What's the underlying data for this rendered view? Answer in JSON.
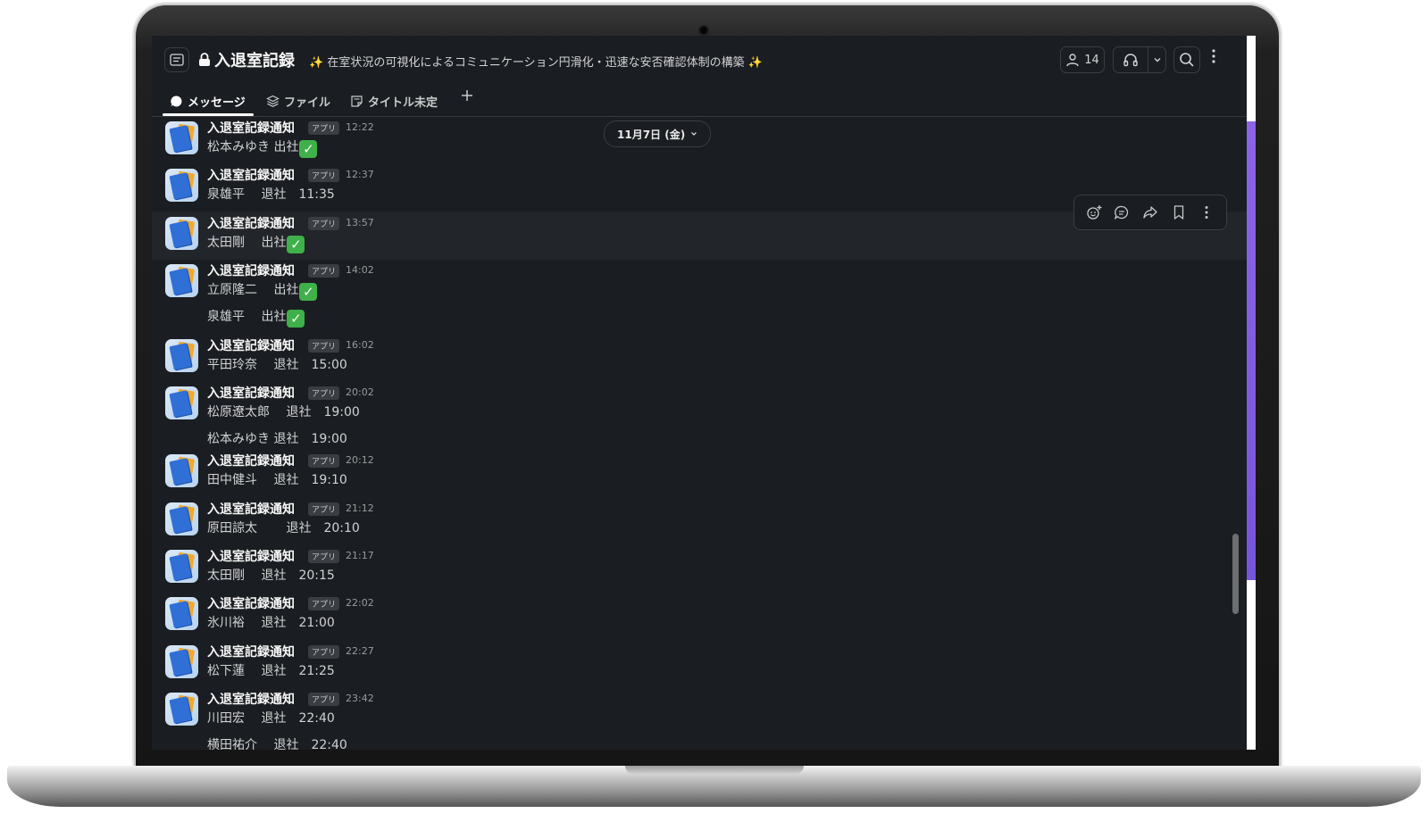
{
  "channel": {
    "title": "入退室記録",
    "topic": "✨ 在室状況の可視化によるコミュニケーション円滑化・迅速な安否確認体制の構築 ✨",
    "member_count": "14"
  },
  "tabs": [
    {
      "label": "メッセージ",
      "icon": "message-icon"
    },
    {
      "label": "ファイル",
      "icon": "layers-icon"
    },
    {
      "label": "タイトル未定",
      "icon": "canvas-icon"
    }
  ],
  "date_divider": "11月7日 (金)",
  "app_badge": "アプリ",
  "sender": "入退室記録通知",
  "messages": [
    {
      "time": "12:22",
      "lines": [
        "松本みゆき 出社"
      ],
      "checks": [
        true
      ]
    },
    {
      "time": "12:37",
      "lines": [
        "泉雄平　 退社　11:35"
      ],
      "checks": [
        false
      ]
    },
    {
      "time": "13:57",
      "lines": [
        "太田剛　 出社"
      ],
      "checks": [
        true
      ]
    },
    {
      "time": "14:02",
      "lines": [
        "立原隆二　 出社",
        "泉雄平　 出社"
      ],
      "checks": [
        true,
        true
      ]
    },
    {
      "time": "16:02",
      "lines": [
        "平田玲奈　 退社　15:00"
      ],
      "checks": [
        false
      ]
    },
    {
      "time": "20:02",
      "lines": [
        "松原遼太郎　 退社　19:00",
        "松本みゆき 退社　19:00"
      ],
      "checks": [
        false,
        false
      ]
    },
    {
      "time": "20:12",
      "lines": [
        "田中健斗　 退社　19:10"
      ],
      "checks": [
        false
      ]
    },
    {
      "time": "21:12",
      "lines": [
        "原田諒太　　 退社　20:10"
      ],
      "checks": [
        false
      ]
    },
    {
      "time": "21:17",
      "lines": [
        "太田剛　 退社　20:15"
      ],
      "checks": [
        false
      ]
    },
    {
      "time": "22:02",
      "lines": [
        "氷川裕　 退社　21:00"
      ],
      "checks": [
        false
      ]
    },
    {
      "time": "22:27",
      "lines": [
        "松下蓮　 退社　21:25"
      ],
      "checks": [
        false
      ]
    },
    {
      "time": "23:42",
      "lines": [
        "川田宏　 退社　22:40",
        "横田祐介　 退社　22:40"
      ],
      "checks": [
        false,
        false
      ]
    }
  ],
  "colors": {
    "background": "#1a1d21",
    "accent_rail": "#7c5ce0",
    "check_green": "#3fb04a"
  }
}
